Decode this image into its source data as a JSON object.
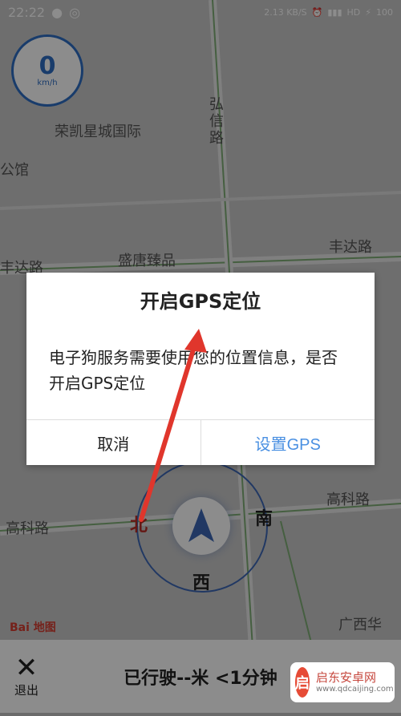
{
  "status_bar": {
    "time": "22:22",
    "network_speed": "2.13 KB/S",
    "battery": "100"
  },
  "map": {
    "speed": {
      "value": "0",
      "unit": "km/h"
    },
    "labels": {
      "rongkai": "荣凯星城国际",
      "gongguan": "公馆",
      "hongxin": "弘信路",
      "fengda_left": "丰达路",
      "fengda_right": "丰达路",
      "shengtang": "盛唐臻品",
      "gaoke_left": "高科路",
      "gaoke_right": "高科路",
      "guangxi": "广西华"
    },
    "compass": {
      "north": "北",
      "south": "南",
      "west": "西"
    },
    "baidu_logo": "Bai 地图"
  },
  "bottom_bar": {
    "exit_label": "退出",
    "trip_status": "已行驶--米 <1分钟"
  },
  "dialog": {
    "title": "开启GPS定位",
    "message": "电子狗服务需要使用您的位置信息，是否开启GPS定位",
    "cancel": "取消",
    "confirm": "设置GPS"
  },
  "watermark": {
    "brand": "启东安卓网",
    "url": "www.qdcaijing.com"
  },
  "colors": {
    "accent": "#4a90e2",
    "arrow": "#e0362c"
  }
}
